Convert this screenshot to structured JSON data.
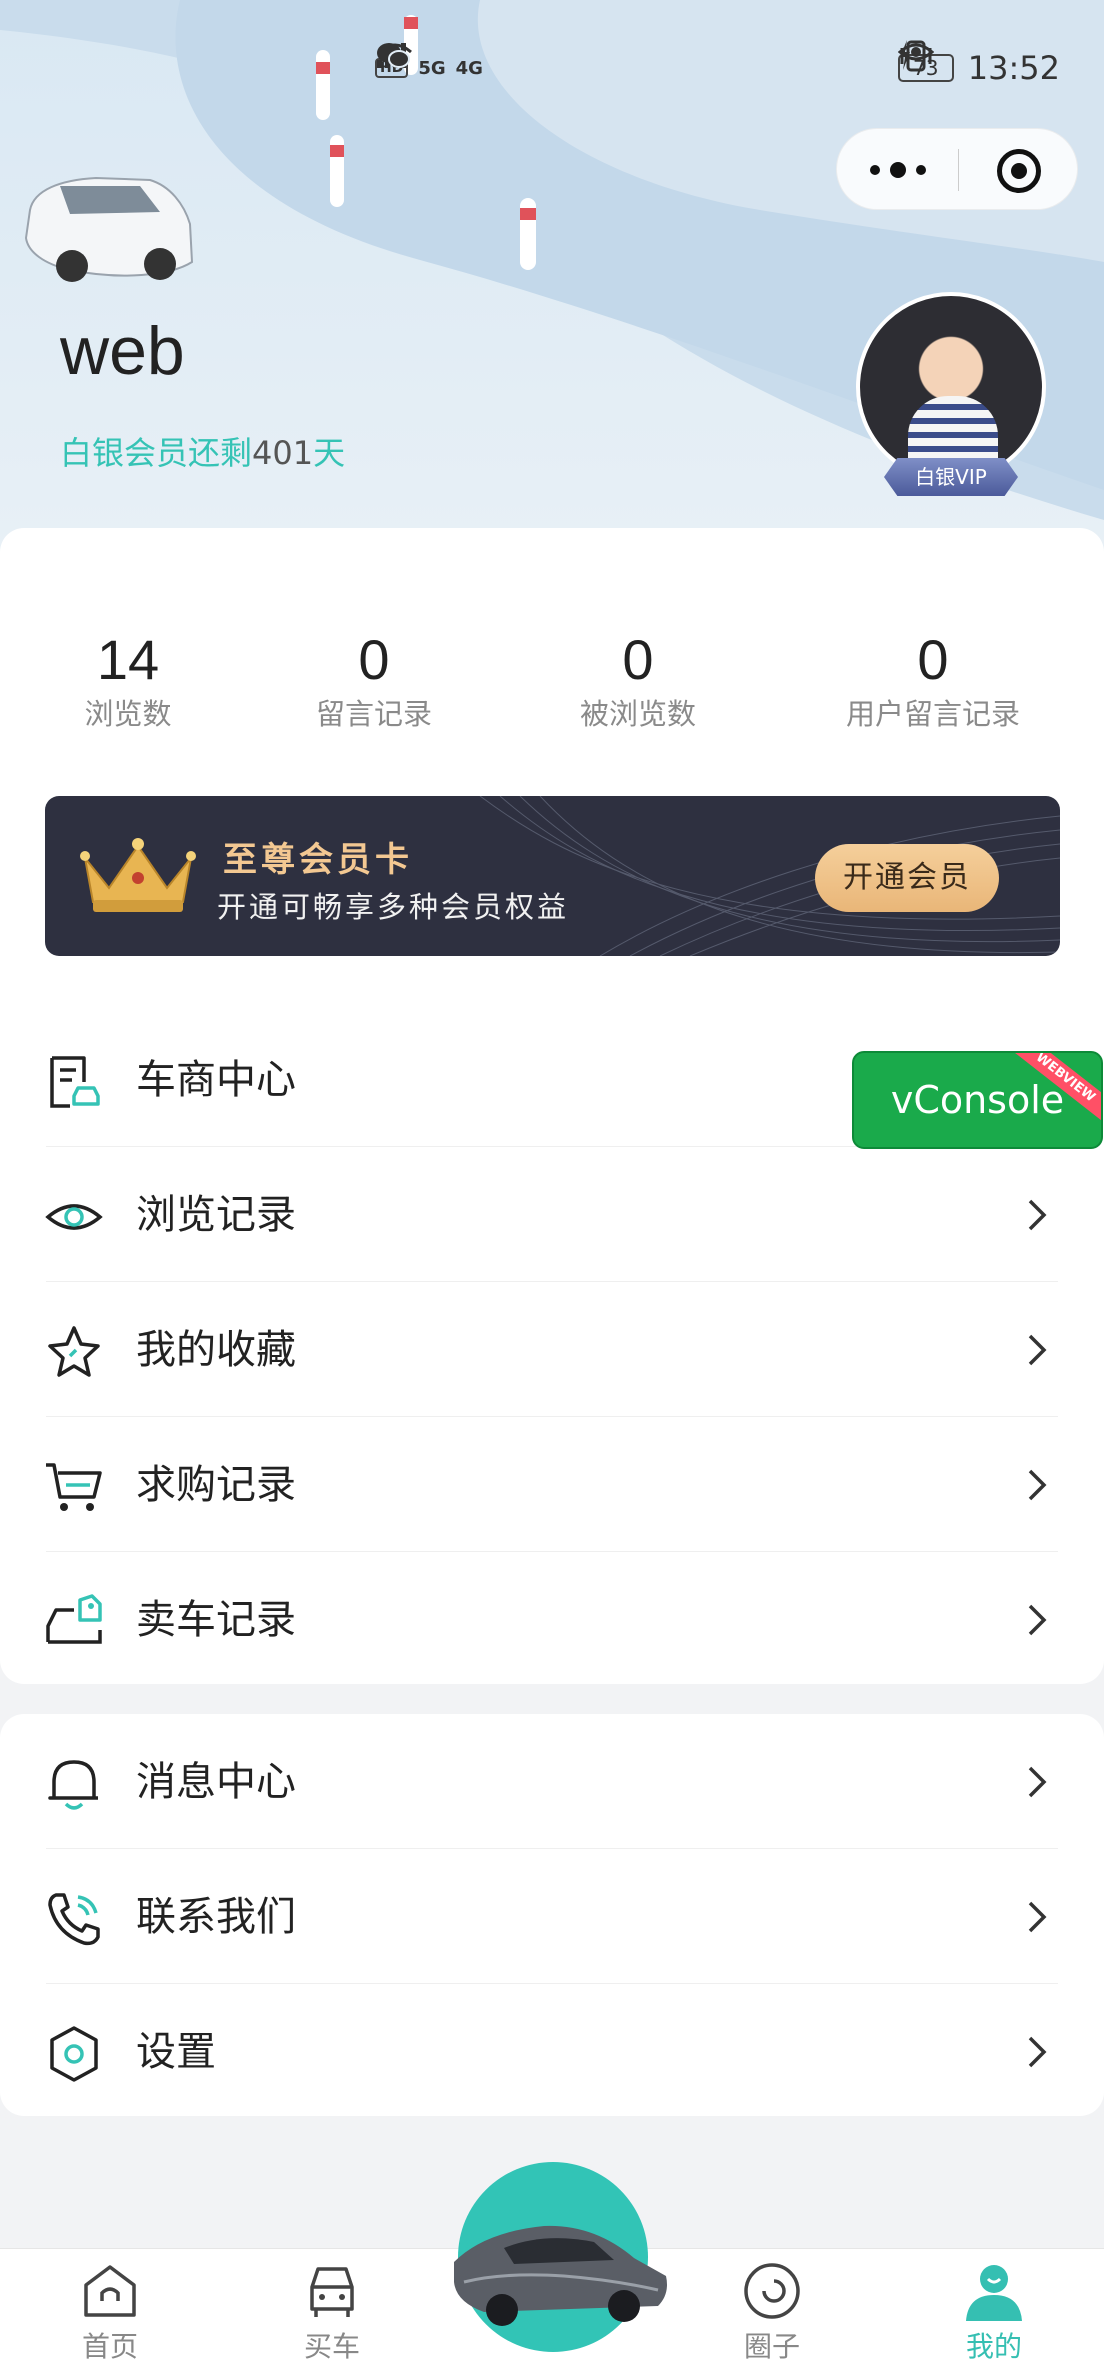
{
  "status_bar": {
    "net_tags": [
      "HD",
      "HD"
    ],
    "net_labels": [
      "5G",
      "4G"
    ],
    "battery": "73",
    "time": "13:52"
  },
  "profile": {
    "username": "web",
    "member_prefix": "白银会员还剩",
    "member_days": "401",
    "member_suffix": "天",
    "vip_badge": "白银VIP"
  },
  "stats": [
    {
      "value": "14",
      "label": "浏览数"
    },
    {
      "value": "0",
      "label": "留言记录"
    },
    {
      "value": "0",
      "label": "被浏览数"
    },
    {
      "value": "0",
      "label": "用户留言记录"
    }
  ],
  "vip_card": {
    "title": "至尊会员卡",
    "subtitle": "开通可畅享多种会员权益",
    "button": "开通会员"
  },
  "menu_main": [
    {
      "label": "车商中心",
      "icon": "dealer-doc-icon"
    },
    {
      "label": "浏览记录",
      "icon": "eye-icon"
    },
    {
      "label": "我的收藏",
      "icon": "star-icon"
    },
    {
      "label": "求购记录",
      "icon": "cart-icon"
    },
    {
      "label": "卖车记录",
      "icon": "car-tag-icon"
    }
  ],
  "menu_secondary": [
    {
      "label": "消息中心",
      "icon": "bell-icon"
    },
    {
      "label": "联系我们",
      "icon": "phone-icon"
    },
    {
      "label": "设置",
      "icon": "hexagon-settings-icon"
    }
  ],
  "vconsole": {
    "label": "vConsole",
    "ribbon": "WEBVIEW"
  },
  "tabbar": [
    {
      "label": "首页",
      "icon": "home-icon"
    },
    {
      "label": "买车",
      "icon": "car-front-icon"
    },
    {
      "label": "圈子",
      "icon": "circle-icon"
    },
    {
      "label": "我的",
      "icon": "user-icon",
      "active": true
    }
  ],
  "colors": {
    "accent": "#35c3b5",
    "vip_gold": "#f3c892",
    "vip_card_bg": "#2e3040"
  }
}
